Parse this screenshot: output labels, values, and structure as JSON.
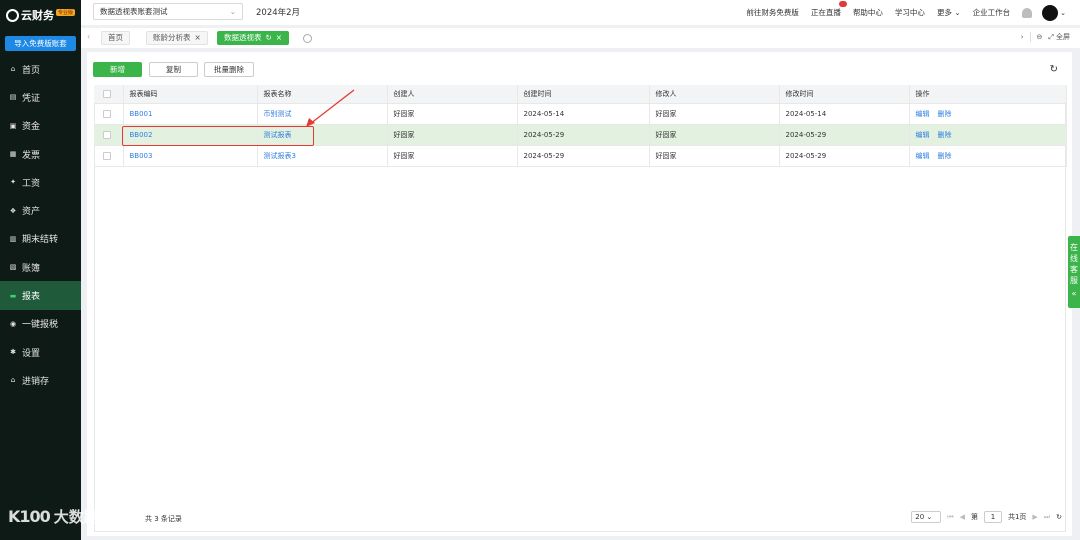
{
  "sidebar": {
    "brand": "云财务",
    "badge": "专业版",
    "import_label": "导入免费版账套",
    "items": [
      {
        "icon": "home-icon",
        "label": "首页"
      },
      {
        "icon": "voucher-icon",
        "label": "凭证"
      },
      {
        "icon": "funds-icon",
        "label": "资金"
      },
      {
        "icon": "invoice-icon",
        "label": "发票"
      },
      {
        "icon": "salary-icon",
        "label": "工资"
      },
      {
        "icon": "assets-icon",
        "label": "资产"
      },
      {
        "icon": "period-close-icon",
        "label": "期末结转"
      },
      {
        "icon": "books-icon",
        "label": "账簿"
      },
      {
        "icon": "report-icon",
        "label": "报表"
      },
      {
        "icon": "tax-icon",
        "label": "一键报税"
      },
      {
        "icon": "gear-icon",
        "label": "设置"
      },
      {
        "icon": "inventory-icon",
        "label": "进销存"
      }
    ]
  },
  "topbar": {
    "ledger": "数据透视表账套测试",
    "period": "2024年2月",
    "links": [
      "前往财务免费版",
      "正在直播",
      "帮助中心",
      "学习中心",
      "更多",
      "企业工作台"
    ]
  },
  "tabs": [
    {
      "label": "首页"
    },
    {
      "label": "账龄分析表"
    },
    {
      "label": "数据透视表"
    }
  ],
  "fullscreen_label": "全屏",
  "toolbar": {
    "add_label": "新增",
    "copy_label": "复制",
    "batch_delete_label": "批量删除"
  },
  "table": {
    "headers": [
      "报表编码",
      "报表名称",
      "创建人",
      "创建时间",
      "修改人",
      "修改时间",
      "操作"
    ],
    "rows": [
      {
        "code": "BB001",
        "name": "币别测试",
        "creator": "好固家",
        "created": "2024-05-14",
        "modifier": "好固家",
        "modified": "2024-05-14",
        "edit": "编辑",
        "delete": "删除"
      },
      {
        "code": "BB002",
        "name": "测试报表",
        "creator": "好固家",
        "created": "2024-05-29",
        "modifier": "好固家",
        "modified": "2024-05-29",
        "edit": "编辑",
        "delete": "删除"
      },
      {
        "code": "BB003",
        "name": "测试报表3",
        "creator": "好固家",
        "created": "2024-05-29",
        "modifier": "好固家",
        "modified": "2024-05-29",
        "edit": "编辑",
        "delete": "删除"
      }
    ]
  },
  "pager": {
    "total_label": "共 3 条记录",
    "page_size": "20",
    "page_prefix": "第",
    "page": "1",
    "page_suffix": "共1页"
  },
  "service_label": "在线客服",
  "watermark": {
    "logo": "K100",
    "text": "大数跨境"
  }
}
